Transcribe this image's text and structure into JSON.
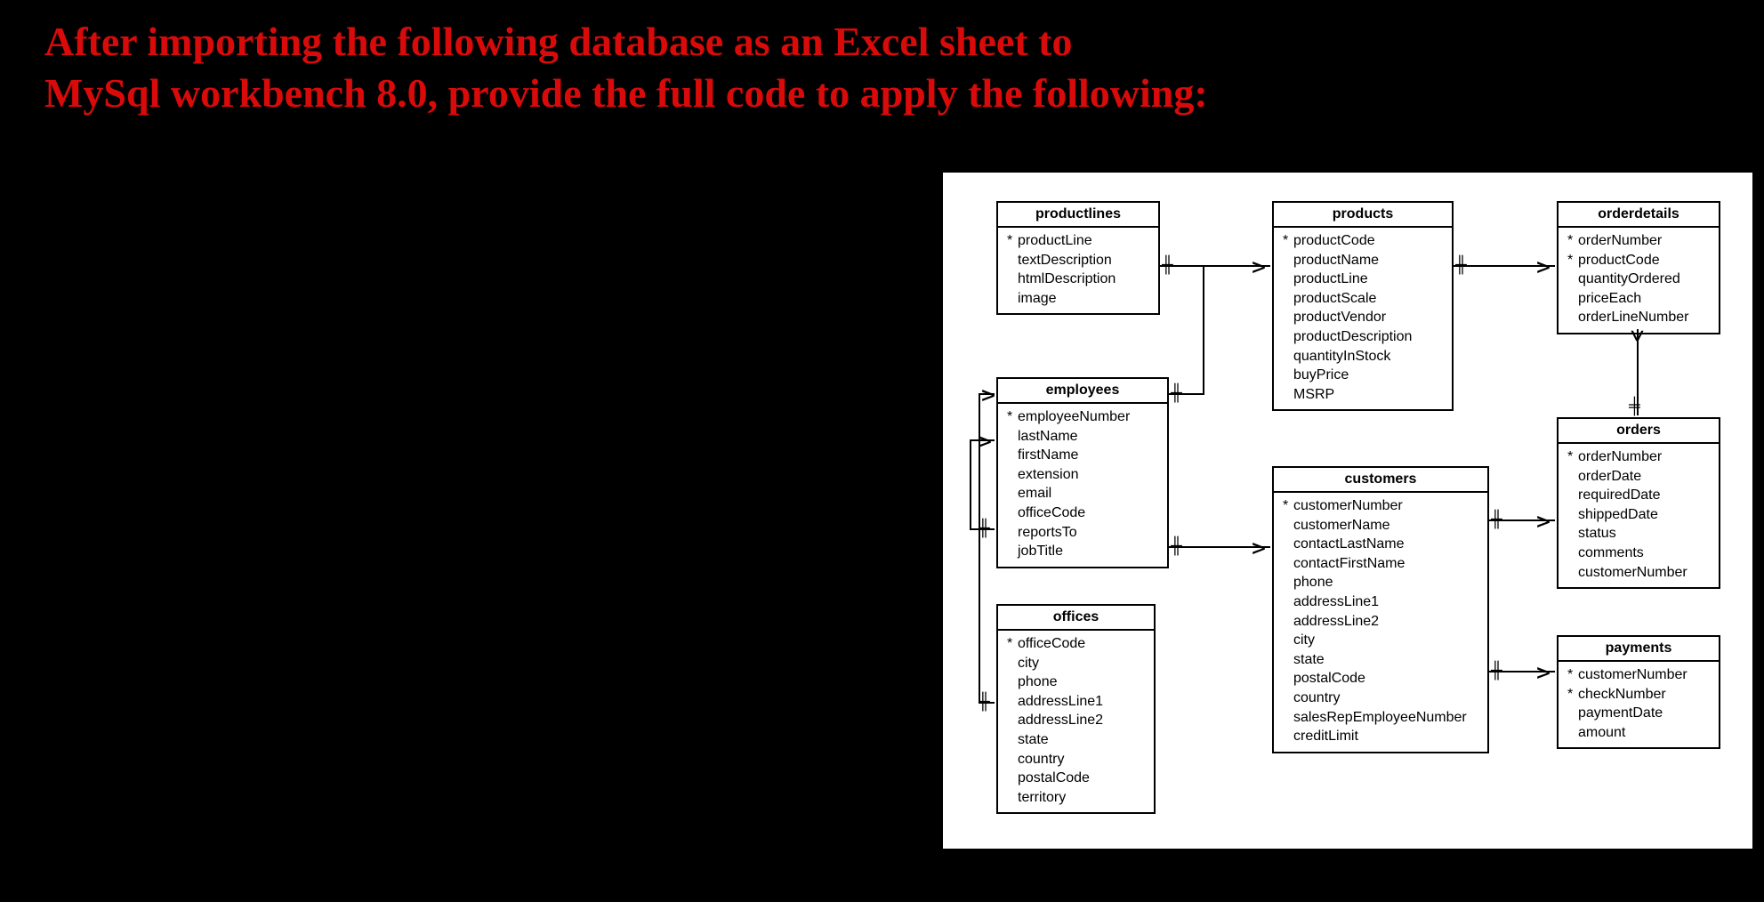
{
  "prompt": {
    "line1": "After importing the following database as an Excel sheet to",
    "line2": "MySql workbench 8.0, provide the full code to apply the following:"
  },
  "tables": {
    "productlines": {
      "title": "productlines",
      "cols": [
        {
          "pk": true,
          "name": "productLine"
        },
        {
          "pk": false,
          "name": "textDescription"
        },
        {
          "pk": false,
          "name": "htmlDescription"
        },
        {
          "pk": false,
          "name": "image"
        }
      ]
    },
    "products": {
      "title": "products",
      "cols": [
        {
          "pk": true,
          "name": "productCode"
        },
        {
          "pk": false,
          "name": "productName"
        },
        {
          "pk": false,
          "name": "productLine"
        },
        {
          "pk": false,
          "name": "productScale"
        },
        {
          "pk": false,
          "name": "productVendor"
        },
        {
          "pk": false,
          "name": "productDescription"
        },
        {
          "pk": false,
          "name": "quantityInStock"
        },
        {
          "pk": false,
          "name": "buyPrice"
        },
        {
          "pk": false,
          "name": "MSRP"
        }
      ]
    },
    "orderdetails": {
      "title": "orderdetails",
      "cols": [
        {
          "pk": true,
          "name": "orderNumber"
        },
        {
          "pk": true,
          "name": "productCode"
        },
        {
          "pk": false,
          "name": "quantityOrdered"
        },
        {
          "pk": false,
          "name": "priceEach"
        },
        {
          "pk": false,
          "name": "orderLineNumber"
        }
      ]
    },
    "employees": {
      "title": "employees",
      "cols": [
        {
          "pk": true,
          "name": "employeeNumber"
        },
        {
          "pk": false,
          "name": "lastName"
        },
        {
          "pk": false,
          "name": "firstName"
        },
        {
          "pk": false,
          "name": "extension"
        },
        {
          "pk": false,
          "name": "email"
        },
        {
          "pk": false,
          "name": "officeCode"
        },
        {
          "pk": false,
          "name": "reportsTo"
        },
        {
          "pk": false,
          "name": "jobTitle"
        }
      ]
    },
    "offices": {
      "title": "offices",
      "cols": [
        {
          "pk": true,
          "name": "officeCode"
        },
        {
          "pk": false,
          "name": "city"
        },
        {
          "pk": false,
          "name": "phone"
        },
        {
          "pk": false,
          "name": "addressLine1"
        },
        {
          "pk": false,
          "name": "addressLine2"
        },
        {
          "pk": false,
          "name": "state"
        },
        {
          "pk": false,
          "name": "country"
        },
        {
          "pk": false,
          "name": "postalCode"
        },
        {
          "pk": false,
          "name": "territory"
        }
      ]
    },
    "customers": {
      "title": "customers",
      "cols": [
        {
          "pk": true,
          "name": "customerNumber"
        },
        {
          "pk": false,
          "name": "customerName"
        },
        {
          "pk": false,
          "name": "contactLastName"
        },
        {
          "pk": false,
          "name": "contactFirstName"
        },
        {
          "pk": false,
          "name": "phone"
        },
        {
          "pk": false,
          "name": "addressLine1"
        },
        {
          "pk": false,
          "name": "addressLine2"
        },
        {
          "pk": false,
          "name": "city"
        },
        {
          "pk": false,
          "name": "state"
        },
        {
          "pk": false,
          "name": "postalCode"
        },
        {
          "pk": false,
          "name": "country"
        },
        {
          "pk": false,
          "name": "salesRepEmployeeNumber"
        },
        {
          "pk": false,
          "name": "creditLimit"
        }
      ]
    },
    "orders": {
      "title": "orders",
      "cols": [
        {
          "pk": true,
          "name": "orderNumber"
        },
        {
          "pk": false,
          "name": "orderDate"
        },
        {
          "pk": false,
          "name": "requiredDate"
        },
        {
          "pk": false,
          "name": "shippedDate"
        },
        {
          "pk": false,
          "name": "status"
        },
        {
          "pk": false,
          "name": "comments"
        },
        {
          "pk": false,
          "name": "customerNumber"
        }
      ]
    },
    "payments": {
      "title": "payments",
      "cols": [
        {
          "pk": true,
          "name": "customerNumber"
        },
        {
          "pk": true,
          "name": "checkNumber"
        },
        {
          "pk": false,
          "name": "paymentDate"
        },
        {
          "pk": false,
          "name": "amount"
        }
      ]
    }
  },
  "relationships": [
    {
      "from": "productlines",
      "to": "products",
      "card": "one-to-many"
    },
    {
      "from": "products",
      "to": "orderdetails",
      "card": "one-to-many"
    },
    {
      "from": "orderdetails",
      "to": "orders",
      "card": "many-to-one"
    },
    {
      "from": "customers",
      "to": "orders",
      "card": "one-to-many"
    },
    {
      "from": "customers",
      "to": "payments",
      "card": "one-to-many"
    },
    {
      "from": "employees",
      "to": "customers",
      "card": "one-to-many"
    },
    {
      "from": "employees",
      "to": "employees",
      "card": "self-one-to-many"
    },
    {
      "from": "offices",
      "to": "employees",
      "card": "one-to-many"
    }
  ]
}
